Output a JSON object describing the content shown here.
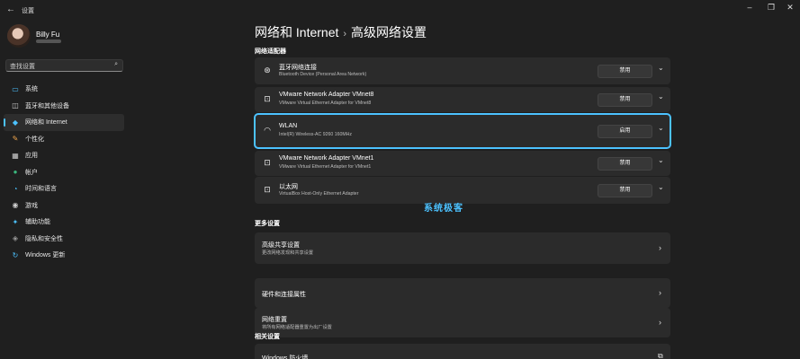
{
  "window": {
    "title": "设置",
    "back_glyph": "←",
    "minimize_glyph": "–",
    "maximize_glyph": "❐",
    "close_glyph": "✕"
  },
  "user": {
    "name": "Billy Fu"
  },
  "search": {
    "placeholder": "查找设置",
    "icon": "search-icon",
    "glyph": "⌕"
  },
  "nav": [
    {
      "label": "系统",
      "icon": "monitor-icon",
      "glyph": "▭",
      "color": "#4cc2ff"
    },
    {
      "label": "蓝牙和其他设备",
      "icon": "bluetooth-devices-icon",
      "glyph": "◫",
      "color": "#cfcfcf"
    },
    {
      "label": "网络和 Internet",
      "icon": "wifi-icon",
      "glyph": "◆",
      "color": "#4cc2ff",
      "active": true
    },
    {
      "label": "个性化",
      "icon": "brush-icon",
      "glyph": "✎",
      "color": "#f0a64d"
    },
    {
      "label": "应用",
      "icon": "apps-icon",
      "glyph": "▦",
      "color": "#cfcfcf"
    },
    {
      "label": "帐户",
      "icon": "account-icon",
      "glyph": "●",
      "color": "#3bb77e"
    },
    {
      "label": "时间和语言",
      "icon": "globe-clock-icon",
      "glyph": "◔",
      "color": "#4cc2ff"
    },
    {
      "label": "游戏",
      "icon": "gamepad-icon",
      "glyph": "◉",
      "color": "#cfcfcf"
    },
    {
      "label": "辅助功能",
      "icon": "accessibility-icon",
      "glyph": "✦",
      "color": "#4cc2ff"
    },
    {
      "label": "隐私和安全性",
      "icon": "shield-icon",
      "glyph": "◈",
      "color": "#9a9a9a"
    },
    {
      "label": "Windows 更新",
      "icon": "update-icon",
      "glyph": "↻",
      "color": "#4cc2ff"
    }
  ],
  "breadcrumb": {
    "parent": "网络和 Internet",
    "separator": "›",
    "current": "高级网络设置"
  },
  "sections": {
    "adapters": "网络适配器",
    "more": "更多设置",
    "related": "相关设置"
  },
  "adapters": [
    {
      "name": "蓝牙网络连接",
      "desc": "Bluetooth Device (Personal Area Network)",
      "action": "禁用",
      "icon": "bluetooth-network-icon",
      "glyph": "⊛",
      "chevron": "⌄"
    },
    {
      "name": "VMware Network Adapter VMnet8",
      "desc": "VMware Virtual Ethernet Adapter for VMnet8",
      "action": "禁用",
      "icon": "ethernet-icon",
      "glyph": "⊡",
      "chevron": "⌄"
    },
    {
      "name": "WLAN",
      "desc": "Intel(R) Wireless-AC 9260 160MHz",
      "action": "启用",
      "icon": "wifi-icon",
      "glyph": "◠",
      "chevron": "⌄",
      "selected": true
    },
    {
      "name": "VMware Network Adapter VMnet1",
      "desc": "VMware Virtual Ethernet Adapter for VMnet1",
      "action": "禁用",
      "icon": "ethernet-icon",
      "glyph": "⊡",
      "chevron": "⌄"
    },
    {
      "name": "以太网",
      "desc": "VirtualBox Host-Only Ethernet Adapter",
      "action": "禁用",
      "icon": "ethernet-icon",
      "glyph": "⊡",
      "chevron": "⌄"
    }
  ],
  "more_settings": [
    {
      "title": "高级共享设置",
      "desc": "更改网络发现和共享设置",
      "chevron": "›"
    },
    {
      "title": "硬件和连接属性",
      "desc": "",
      "chevron": "›"
    },
    {
      "title": "网络重置",
      "desc": "将所有网络适配器重置为出厂设置",
      "chevron": "›"
    }
  ],
  "related": [
    {
      "title": "Windows 防火墙",
      "icon": "external-link-icon",
      "glyph": "⧉"
    }
  ],
  "watermark": "系统极客"
}
